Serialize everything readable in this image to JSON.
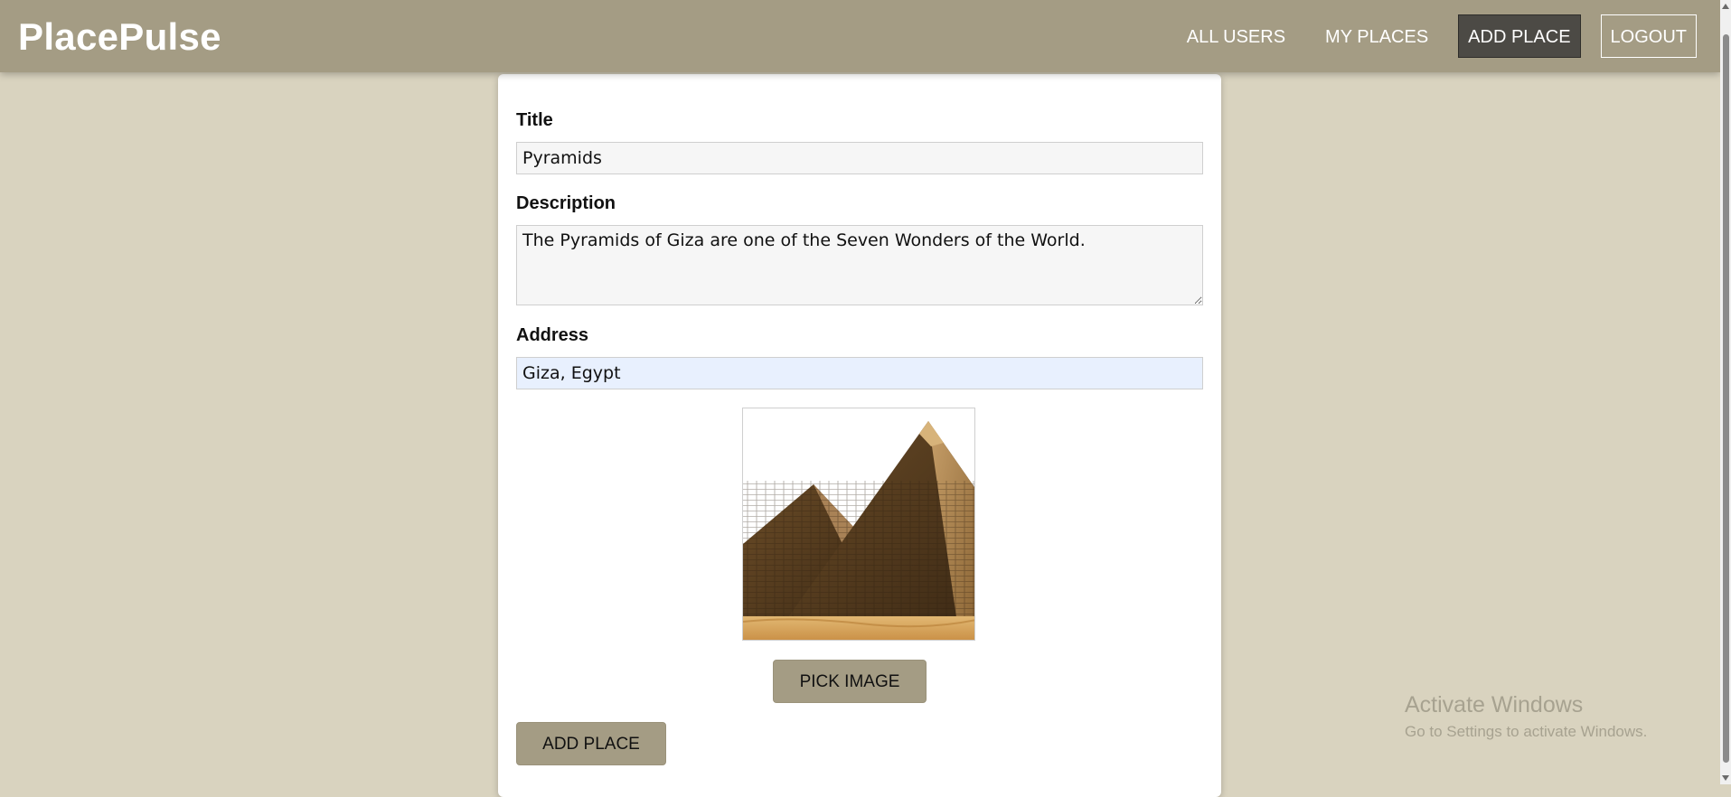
{
  "header": {
    "logo": "PlacePulse",
    "nav": [
      {
        "label": "ALL USERS"
      },
      {
        "label": "MY PLACES"
      },
      {
        "label": "ADD PLACE",
        "active": true
      },
      {
        "label": "LOGOUT"
      }
    ]
  },
  "form": {
    "title_label": "Title",
    "title_value": "Pyramids",
    "description_label": "Description",
    "description_value": "The Pyramids of Giza are one of the Seven Wonders of the World.",
    "address_label": "Address",
    "address_value": "Giza, Egypt",
    "image_alt": "Preview",
    "pick_image_label": "PICK IMAGE",
    "submit_label": "ADD PLACE"
  },
  "watermark": {
    "title": "Activate Windows",
    "subtitle": "Go to Settings to activate Windows."
  },
  "colors": {
    "header_bg": "#a49c84",
    "page_bg": "#d9d3bf",
    "active_nav_bg": "#4c4a45",
    "button_bg": "#a49c84",
    "autofill_bg": "#e8f0fe"
  }
}
